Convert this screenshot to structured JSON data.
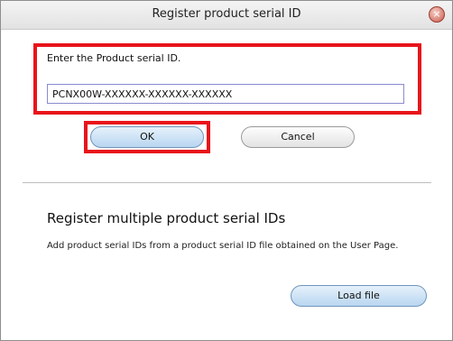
{
  "window": {
    "title": "Register product serial ID",
    "close_symbol": "×"
  },
  "single": {
    "label": "Enter the Product serial ID.",
    "input_value": "PCNX00W-XXXXXX-XXXXXX-XXXXXX",
    "ok_label": "OK",
    "cancel_label": "Cancel"
  },
  "multiple": {
    "heading": "Register multiple product serial IDs",
    "description": "Add product serial IDs from a product serial ID file obtained on the User Page.",
    "load_label": "Load file"
  },
  "icons": {
    "close": "close-icon"
  },
  "colors": {
    "highlight": "#e8141b",
    "primary_button": "#b9d6f0"
  }
}
